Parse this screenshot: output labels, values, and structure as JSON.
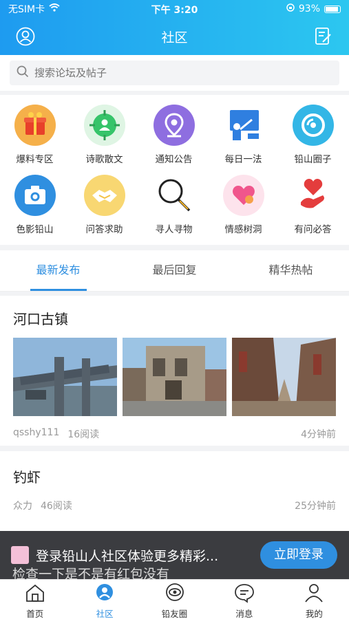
{
  "status": {
    "carrier": "无SIM卡",
    "time": "下午 3:20",
    "battery": "93%"
  },
  "header": {
    "title": "社区"
  },
  "search": {
    "placeholder": "搜索论坛及帖子"
  },
  "categories": [
    {
      "label": "爆料专区",
      "icon": "gift-icon",
      "color": "#f05a3c"
    },
    {
      "label": "诗歌散文",
      "icon": "target-person-icon",
      "color": "#36c46a"
    },
    {
      "label": "通知公告",
      "icon": "location-pin-icon",
      "color": "#8e6ee0"
    },
    {
      "label": "每日一法",
      "icon": "lecture-icon",
      "color": "#2f7fe0"
    },
    {
      "label": "铅山圈子",
      "icon": "disc-icon",
      "color": "#33b6e6"
    },
    {
      "label": "色影铅山",
      "icon": "camera-icon",
      "color": "#2f8fe0"
    },
    {
      "label": "问答求助",
      "icon": "handshake-icon",
      "color": "#f3c245"
    },
    {
      "label": "寻人寻物",
      "icon": "magnifier-icon",
      "color": "#222222"
    },
    {
      "label": "情感树洞",
      "icon": "heart-icon",
      "color": "#f0568c"
    },
    {
      "label": "有问必答",
      "icon": "heart-hand-icon",
      "color": "#e43d3d"
    }
  ],
  "tabs": [
    {
      "label": "最新发布",
      "active": true
    },
    {
      "label": "最后回复",
      "active": false
    },
    {
      "label": "精华热帖",
      "active": false
    }
  ],
  "posts": [
    {
      "title": "河口古镇",
      "author": "qsshy111",
      "reads": "16阅读",
      "time": "4分钟前"
    },
    {
      "title": "钓虾",
      "author": "众力",
      "reads": "46阅读",
      "time": "25分钟前"
    }
  ],
  "banner": {
    "text": "登录铅山人社区体验更多精彩...",
    "subtext": "检查一下是不是有红包没有",
    "button": "立即登录"
  },
  "bottom_nav": [
    {
      "label": "首页",
      "icon": "home-icon",
      "active": false
    },
    {
      "label": "社区",
      "icon": "community-icon",
      "active": true
    },
    {
      "label": "铅友圈",
      "icon": "circle-eye-icon",
      "active": false
    },
    {
      "label": "消息",
      "icon": "message-icon",
      "active": false
    },
    {
      "label": "我的",
      "icon": "profile-icon",
      "active": false
    }
  ],
  "colors": {
    "accent": "#2f8fe0",
    "header_start": "#1e9bf0",
    "header_end": "#2cc7f0"
  }
}
